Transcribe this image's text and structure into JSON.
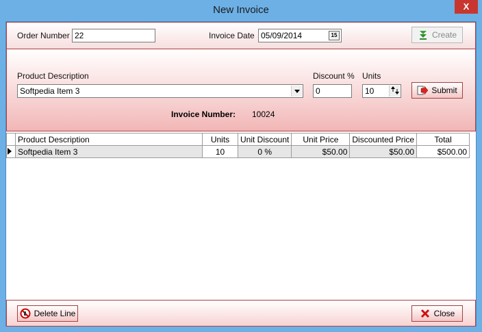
{
  "window": {
    "title": "New Invoice",
    "close_glyph": "X"
  },
  "header": {
    "order_number_label": "Order Number",
    "order_number_value": "22",
    "invoice_date_label": "Invoice Date",
    "invoice_date_value": "05/09/2014",
    "calendar_button_text": "15",
    "create_label": "Create"
  },
  "entry": {
    "product_description_label": "Product Description",
    "product_description_value": "Softpedia Item 3",
    "discount_label": "Discount %",
    "discount_value": "0",
    "units_label": "Units",
    "units_value": "10",
    "submit_label": "Submit",
    "invoice_number_label": "Invoice Number:",
    "invoice_number_value": "10024"
  },
  "grid": {
    "columns": [
      "Product Description",
      "Units",
      "Unit Discount",
      "Unit Price",
      "Discounted Price",
      "Total"
    ],
    "rows": [
      {
        "product": "Softpedia Item 3",
        "units": "10",
        "unit_discount": "0 %",
        "unit_price": "$50.00",
        "discounted_price": "$50.00",
        "total": "$500.00"
      }
    ]
  },
  "footer": {
    "delete_line_label": "Delete Line",
    "close_label": "Close"
  },
  "colors": {
    "titlebar": "#6cb0e6",
    "panel_border": "#b04040",
    "panel_gradient": "#f2b6b6"
  },
  "icons": {
    "create": "green-down-arrows-icon",
    "submit": "red-arrow-page-icon",
    "delete": "red-no-entry-icon",
    "close": "red-x-icon"
  }
}
